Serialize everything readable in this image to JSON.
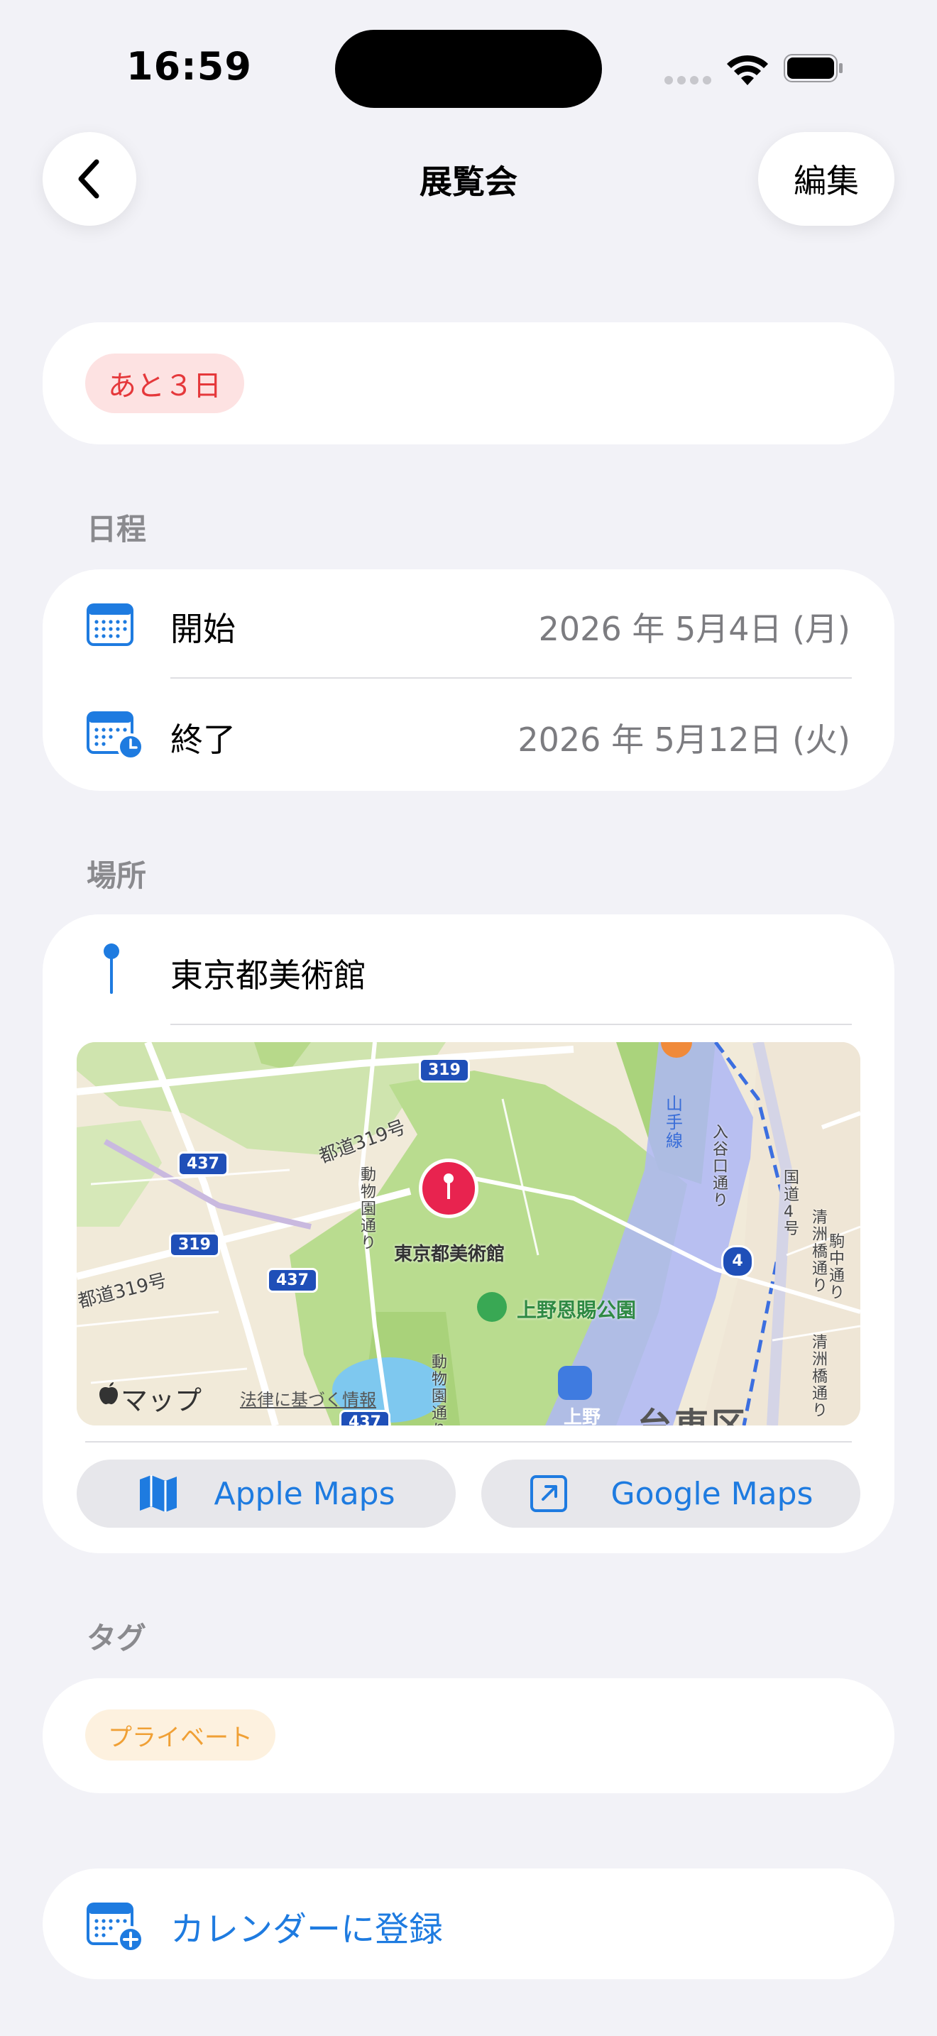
{
  "status_bar": {
    "time": "16:59"
  },
  "nav": {
    "title": "展覧会",
    "edit_label": "編集"
  },
  "countdown": {
    "label": "あと３日"
  },
  "schedule": {
    "section_label": "日程",
    "start_label": "開始",
    "start_value": "2026 年 5月4日 (月)",
    "end_label": "終了",
    "end_value": "2026 年 5月12日 (火)"
  },
  "location": {
    "section_label": "場所",
    "name": "東京都美術館",
    "map": {
      "pin_label": "東京都美術館",
      "park_label": "上野恩賜公園",
      "district_label": "台東区",
      "station_label": "上野",
      "route_319": "319",
      "route_437": "437",
      "route_4": "4",
      "road_left": "都道319号",
      "road_left2": "都道319号",
      "road_zoo1": "動物園通り",
      "road_zoo2": "動物園通り",
      "line_yamanote": "山手線",
      "road_iriya": "入谷口通り",
      "road_national": "国道4号",
      "road_kiyosu1": "清洲橋通り",
      "road_kiyosu2": "清洲橋通り",
      "road_komagata": "駒中通り",
      "maps_brand": "マップ",
      "legal": "法律に基づく情報"
    },
    "apple_maps_label": "Apple Maps",
    "google_maps_label": "Google Maps"
  },
  "tags": {
    "section_label": "タグ",
    "items": [
      "プライベート"
    ]
  },
  "calendar_action": {
    "label": "カレンダーに登録"
  },
  "colors": {
    "accent": "#1e7be0",
    "countdown_red": "#e5383b",
    "tag_orange": "#f0a035"
  }
}
